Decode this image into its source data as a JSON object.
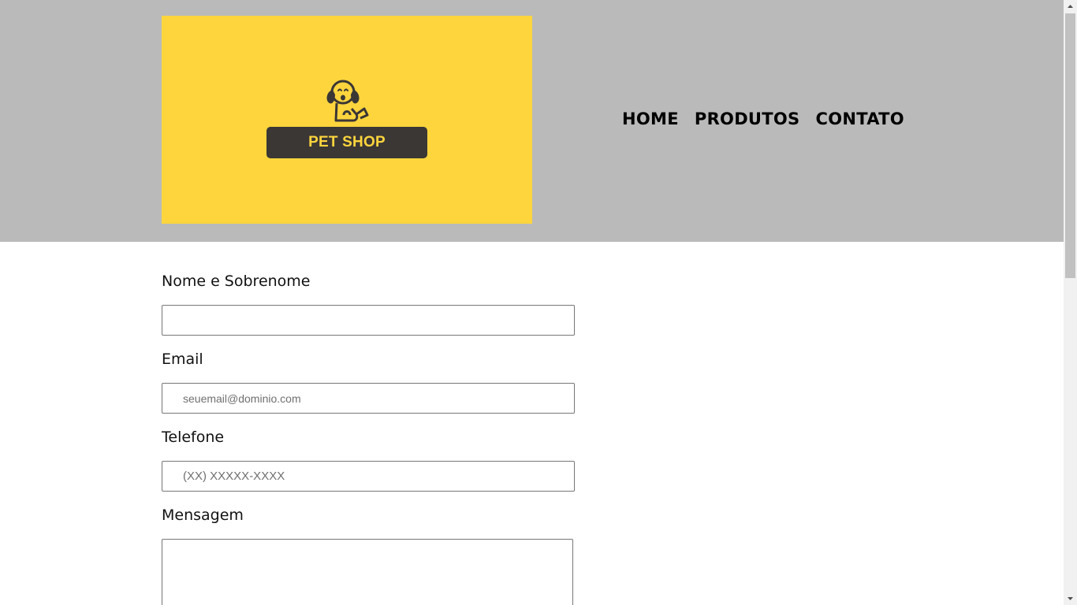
{
  "header": {
    "logo": {
      "text": "PET SHOP",
      "icon": "dog-icon",
      "background_color": "#fed53d",
      "plate_color": "#3a3735"
    },
    "nav": [
      {
        "label": "HOME"
      },
      {
        "label": "PRODUTOS"
      },
      {
        "label": "CONTATO"
      }
    ],
    "background_color": "#bababa"
  },
  "form": {
    "name": {
      "label": "Nome e Sobrenome",
      "value": "",
      "placeholder": ""
    },
    "email": {
      "label": "Email",
      "value": "",
      "placeholder": "seuemail@dominio.com"
    },
    "phone": {
      "label": "Telefone",
      "value": "",
      "placeholder": "(XX) XXXXX-XXXX"
    },
    "message": {
      "label": "Mensagem",
      "value": ""
    }
  }
}
